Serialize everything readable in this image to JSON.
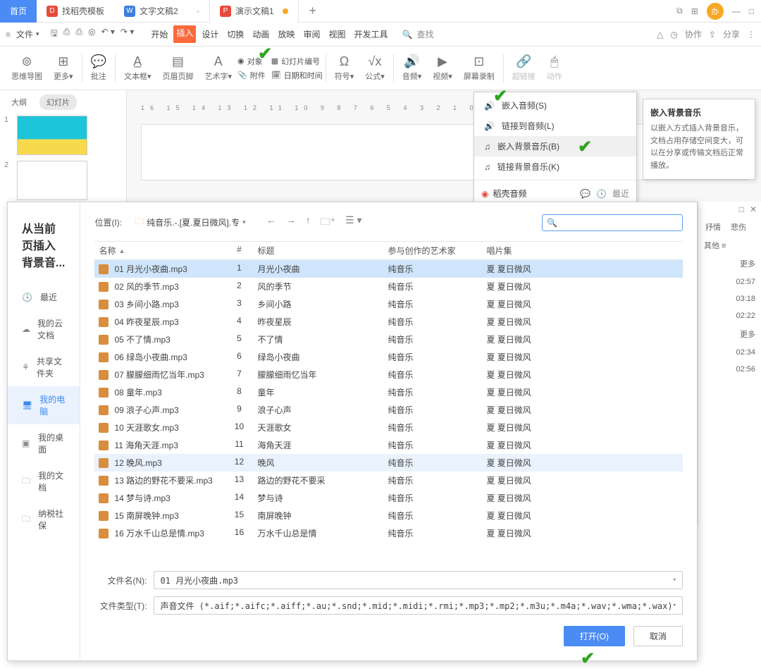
{
  "tabs": {
    "home": "首页",
    "t1": "找稻壳模板",
    "t2": "文字文稿2",
    "t3": "演示文稿1"
  },
  "avatar_text": "办",
  "file_menu": "文件",
  "menu": [
    "开始",
    "插入",
    "设计",
    "切换",
    "动画",
    "放映",
    "审阅",
    "视图",
    "开发工具"
  ],
  "search_label": "查找",
  "collab": "协作",
  "share": "分享",
  "ribbon": {
    "mindmap": "思维导图",
    "more": "更多",
    "comment": "批注",
    "textbox": "文本框",
    "header": "页眉页脚",
    "art": "艺术字",
    "object": "对象",
    "slidenum": "幻灯片编号",
    "attach": "附件",
    "datetime": "日期和时间",
    "symbol": "符号",
    "formula": "公式",
    "audio": "音频",
    "video": "视频",
    "screenrec": "屏幕录制",
    "hyperlink": "超链接",
    "action": "动作"
  },
  "panel": {
    "outline": "大纲",
    "slides": "幻灯片"
  },
  "ruler": "16  15  14  13  12  11  10  9  8  7  6  5  4  3  2  1  0  1",
  "dropdown": {
    "insert_audio": "嵌入音频(S)",
    "link_audio": "链接到音频(L)",
    "insert_bg": "嵌入背景音乐(B)",
    "link_bg": "链接背景音乐(K)",
    "daoke": "稻壳音频",
    "recent": "最近"
  },
  "tooltip": {
    "title": "嵌入背景音乐",
    "body": "以嵌入方式插入背景音乐，文档占用存储空间变大，可以在分享或传输文档后正常播放。"
  },
  "side": {
    "tab1": "抒情",
    "tab2": "悲伤",
    "other": "其他",
    "more": "更多",
    "times": [
      "02:57",
      "03:18",
      "02:22",
      "02:34",
      "02:56"
    ]
  },
  "dialog": {
    "title": "从当前页插入背景音...",
    "nav": {
      "recent": "最近",
      "cloud": "我的云文档",
      "shared": "共享文件夹",
      "computer": "我的电脑",
      "desktop": "我的桌面",
      "docs": "我的文档",
      "tax": "纳税社保"
    },
    "loc_label": "位置(I):",
    "path": "纯音乐.-.[夏.夏日微风].专",
    "cols": {
      "name": "名称",
      "num": "#",
      "title": "标题",
      "artist": "参与创作的艺术家",
      "album": "唱片集"
    },
    "artist": "纯音乐",
    "album": "夏 夏日微风",
    "files": [
      {
        "n": "01 月光小夜曲.mp3",
        "i": "1",
        "t": "月光小夜曲"
      },
      {
        "n": "02 风的季节.mp3",
        "i": "2",
        "t": "风的季节"
      },
      {
        "n": "03 乡间小路.mp3",
        "i": "3",
        "t": "乡间小路"
      },
      {
        "n": "04 昨夜星辰.mp3",
        "i": "4",
        "t": "昨夜星辰"
      },
      {
        "n": "05 不了情.mp3",
        "i": "5",
        "t": "不了情"
      },
      {
        "n": "06 绿岛小夜曲.mp3",
        "i": "6",
        "t": "绿岛小夜曲"
      },
      {
        "n": "07 朦朦细雨忆当年.mp3",
        "i": "7",
        "t": "朦朦细雨忆当年"
      },
      {
        "n": "08 童年.mp3",
        "i": "8",
        "t": "童年"
      },
      {
        "n": "09 浪子心声.mp3",
        "i": "9",
        "t": "浪子心声"
      },
      {
        "n": "10 天涯歌女.mp3",
        "i": "10",
        "t": "天涯歌女"
      },
      {
        "n": "11 海角天涯.mp3",
        "i": "11",
        "t": "海角天涯"
      },
      {
        "n": "12 晚风.mp3",
        "i": "12",
        "t": "晚风"
      },
      {
        "n": "13 路边的野花不要采.mp3",
        "i": "13",
        "t": "路边的野花不要采"
      },
      {
        "n": "14 梦与诗.mp3",
        "i": "14",
        "t": "梦与诗"
      },
      {
        "n": "15 南屏晚钟.mp3",
        "i": "15",
        "t": "南屏晚钟"
      },
      {
        "n": "16 万水千山总是情.mp3",
        "i": "16",
        "t": "万水千山总是情"
      }
    ],
    "filename_label": "文件名(N):",
    "filename_value": "01 月光小夜曲.mp3",
    "filetype_label": "文件类型(T):",
    "filetype_value": "声音文件 (*.aif;*.aifc;*.aiff;*.au;*.snd;*.mid;*.midi;*.rmi;*.mp3;*.mp2;*.m3u;*.m4a;*.wav;*.wma;*.wax)",
    "open_btn": "打开(O)",
    "cancel_btn": "取消"
  }
}
